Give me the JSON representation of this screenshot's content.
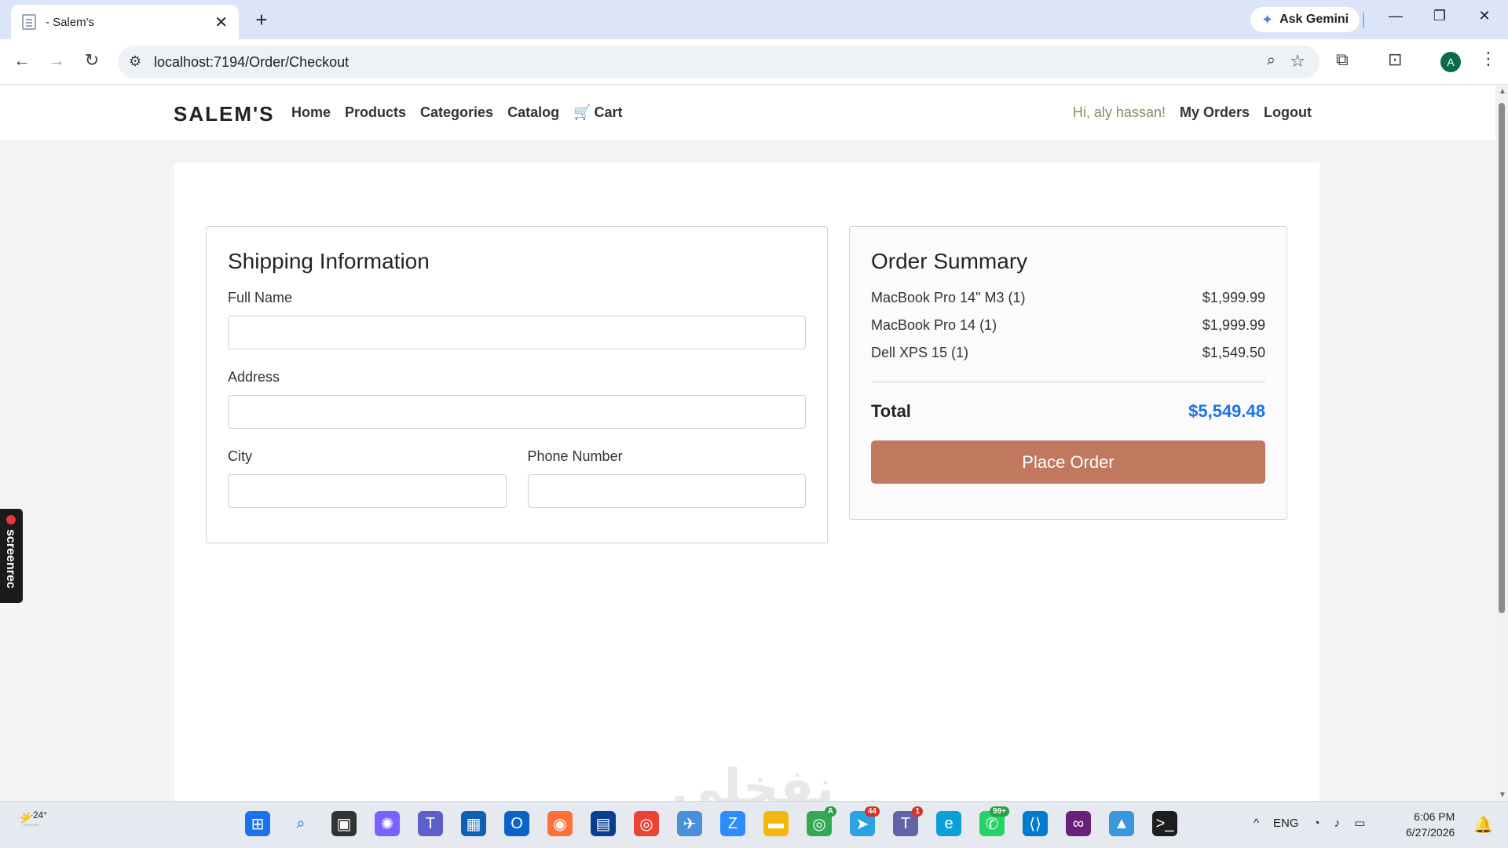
{
  "browser": {
    "tab_title": "- Salem's",
    "new_tab": "+",
    "gemini_label": "Ask Gemini",
    "url": "localhost:7194/Order/Checkout",
    "profile_initial": "A"
  },
  "navbar": {
    "brand": "SALEM'S",
    "links": [
      "Home",
      "Products",
      "Categories",
      "Catalog",
      "Cart"
    ],
    "greeting": "Hi, aly hassan!",
    "my_orders": "My Orders",
    "logout": "Logout"
  },
  "shipping": {
    "title": "Shipping Information",
    "full_name_label": "Full Name",
    "address_label": "Address",
    "city_label": "City",
    "phone_label": "Phone Number",
    "full_name_value": "",
    "address_value": "",
    "city_value": "",
    "phone_value": ""
  },
  "summary": {
    "title": "Order Summary",
    "items": [
      {
        "name": "MacBook Pro 14\" M3 (1)",
        "price": "$1,999.99"
      },
      {
        "name": "MacBook Pro 14 (1)",
        "price": "$1,999.99"
      },
      {
        "name": "Dell XPS 15 (1)",
        "price": "$1,549.50"
      }
    ],
    "total_label": "Total",
    "total_value": "$5,549.48",
    "place_order": "Place Order",
    "total_color": "#1a73e8",
    "button_color": "#c0785e"
  },
  "overlay": {
    "screenrec_label": "screenrec"
  },
  "taskbar": {
    "temperature": "24°",
    "lang": "ENG",
    "time": "6:06 PM",
    "date": "6/27/2026",
    "badges": {
      "chrome": "A",
      "telegram": "44",
      "teams": "1",
      "whatsapp": "99+"
    }
  }
}
